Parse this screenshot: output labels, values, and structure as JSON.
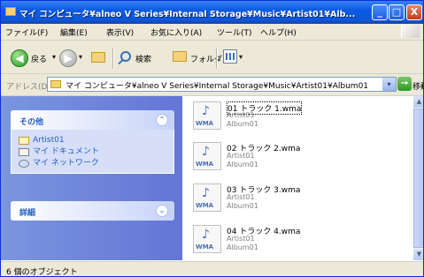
{
  "window": {
    "title": "マイ コンピュータ¥alneo V Series¥Internal Storage¥Music¥Artist01¥Alb...",
    "min_label": "_",
    "max_label": "□",
    "close_label": "X"
  },
  "menubar": {
    "items": [
      "ファイル(F)",
      "編集(E)",
      "表示(V)",
      "お気に入り(A)",
      "ツール(T)",
      "ヘルプ(H)"
    ]
  },
  "toolbar": {
    "back_label": "戻る",
    "back_glyph": "◀",
    "forward_glyph": "▶",
    "dropdown_glyph": "▾",
    "search_label": "検索",
    "folders_label": "フォルダ"
  },
  "address": {
    "label": "アドレス(D)",
    "value": "マイ コンピュータ¥alneo V Series¥Internal Storage¥Music¥Artist01¥Album01",
    "dropdown_glyph": "▾",
    "go_glyph": "→",
    "go_label": "移動"
  },
  "sidebar": {
    "other_panel": {
      "title": "その他",
      "toggle_glyph": "⌃",
      "items": [
        {
          "label": "Artist01",
          "icon": "folder-icon"
        },
        {
          "label": "マイ ドキュメント",
          "icon": "documents-icon"
        },
        {
          "label": "マイ ネットワーク",
          "icon": "network-icon"
        }
      ]
    },
    "details_panel": {
      "title": "詳細",
      "toggle_glyph": "⌄"
    }
  },
  "files": [
    {
      "name": "01 トラック 1.wma",
      "artist": "Artist01",
      "album": "Album01",
      "icon_label": "WMA",
      "selected": true
    },
    {
      "name": "02 トラック 2.wma",
      "artist": "Artist01",
      "album": "Album01",
      "icon_label": "WMA",
      "selected": false
    },
    {
      "name": "03 トラック 3.wma",
      "artist": "Artist01",
      "album": "Album01",
      "icon_label": "WMA",
      "selected": false
    },
    {
      "name": "04 トラック 4.wma",
      "artist": "Artist01",
      "album": "Album01",
      "icon_label": "WMA",
      "selected": false
    }
  ],
  "scrollbar": {
    "up_glyph": "▲",
    "down_glyph": "▼"
  },
  "status": {
    "text": "6 個のオブジェクト"
  }
}
